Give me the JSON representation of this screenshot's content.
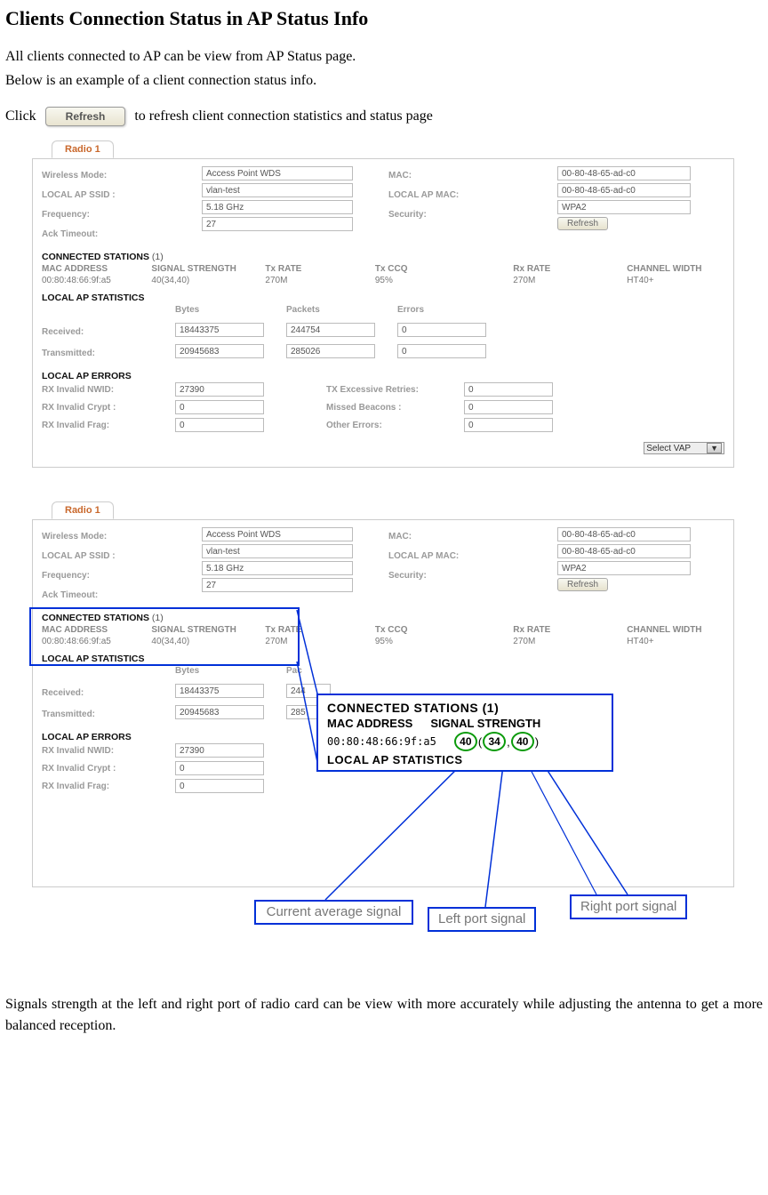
{
  "heading": "Clients Connection Status in AP Status Info",
  "intro1": "All clients connected to AP can be view from AP Status page.",
  "intro2": "Below is an example of a client connection status info.",
  "click_before": "Click",
  "refresh_big": "Refresh",
  "click_after": "to refresh client connection statistics and status page",
  "tab": "Radio 1",
  "labels": {
    "wmode": "Wireless Mode:",
    "ssid": "LOCAL AP SSID :",
    "freq": "Frequency:",
    "ack": "Ack Timeout:",
    "mac": "MAC:",
    "lmac": "LOCAL AP MAC:",
    "sec": "Security:"
  },
  "vals": {
    "wmode": "Access Point WDS",
    "ssid": "vlan-test",
    "freq": "5.18 GHz",
    "ack": "27",
    "mac": "00-80-48-65-ad-c0",
    "lmac": "00-80-48-65-ad-c0",
    "sec": "WPA2"
  },
  "refresh_small": "Refresh",
  "conn_title": "CONNECTED STATIONS",
  "conn_count": "(1)",
  "conn_headers": {
    "h1": "MAC ADDRESS",
    "h2": "SIGNAL STRENGTH",
    "h3": "Tx RATE",
    "h4": "Tx CCQ",
    "h5": "Rx RATE",
    "h6": "CHANNEL WIDTH"
  },
  "conn_vals": {
    "v1": "00:80:48:66:9f:a5",
    "v2": "40(34,40)",
    "v3": "270M",
    "v4": "95%",
    "v5": "270M",
    "v6": "HT40+"
  },
  "local_stats_title": "LOCAL AP STATISTICS",
  "local_stats_headers": {
    "b": "Bytes",
    "p": "Packets",
    "e": "Errors"
  },
  "local_stats": {
    "rx_lbl": "Received:",
    "rx_b": "18443375",
    "rx_p": "244754",
    "rx_e": "0",
    "tx_lbl": "Transmitted:",
    "tx_b": "20945683",
    "tx_p": "285026",
    "tx_e": "0"
  },
  "local_err_title": "LOCAL AP ERRORS",
  "local_err": {
    "nwid_lbl": "RX Invalid NWID:",
    "nwid": "27390",
    "crypt_lbl": "RX Invalid Crypt :",
    "crypt": "0",
    "frag_lbl": "RX Invalid Frag:",
    "frag": "0",
    "retry_lbl": "TX Excessive Retries:",
    "retry": "0",
    "beacon_lbl": "Missed Beacons :",
    "beacon": "0",
    "other_lbl": "Other Errors:",
    "other": "0"
  },
  "select_vap": "Select VAP",
  "second_local_stats_headers": {
    "b": "Bytes",
    "p": "Pac"
  },
  "second_local_stats": {
    "rx_b": "18443375",
    "rx_p": "244",
    "tx_b": "20945683",
    "tx_p": "285"
  },
  "callout": {
    "title": "CONNECTED STATIONS  (1)",
    "h_mac": "MAC ADDRESS",
    "h_sig": "SIGNAL STRENGTH",
    "mac": "00:80:48:66:9f:a5",
    "s1": "40",
    "s2": "34",
    "s3": "40",
    "stats": "LOCAL AP STATISTICS"
  },
  "labels_boxes": {
    "avg": "Current average signal",
    "left": "Left port signal",
    "right": "Right port signal"
  },
  "outro": "Signals strength at the left and right port of radio card can be view with more accurately while adjusting the antenna to get a more balanced reception."
}
